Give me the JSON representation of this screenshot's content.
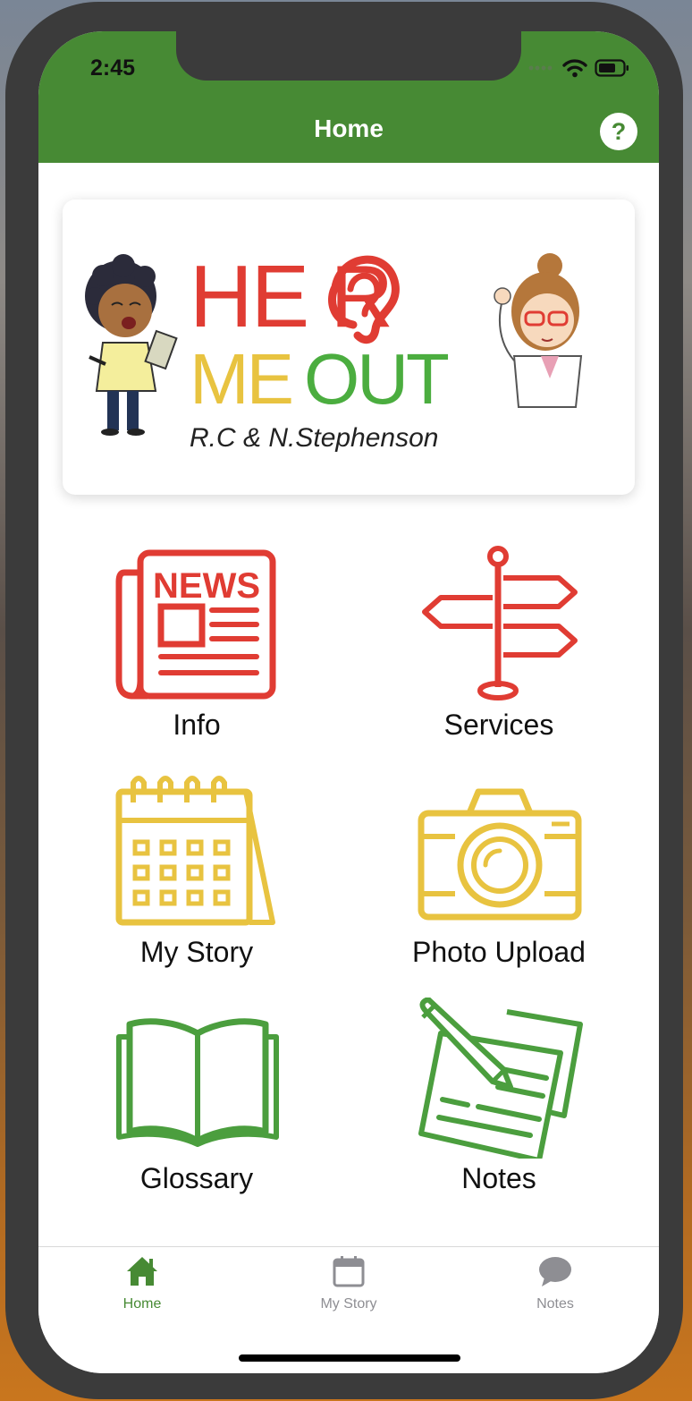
{
  "status_bar": {
    "time": "2:45"
  },
  "header": {
    "title": "Home",
    "help_label": "?"
  },
  "banner": {
    "line1": "HE R",
    "line2_left": "ME",
    "line2_right": "OUT",
    "authors": "R.C & N.Stephenson"
  },
  "tiles": [
    {
      "label": "Info",
      "icon": "newspaper-icon",
      "color": "#e03c33"
    },
    {
      "label": "Services",
      "icon": "signpost-icon",
      "color": "#e03c33"
    },
    {
      "label": "My Story",
      "icon": "calendar-icon",
      "color": "#e8c340"
    },
    {
      "label": "Photo Upload",
      "icon": "camera-icon",
      "color": "#e8c340"
    },
    {
      "label": "Glossary",
      "icon": "book-icon",
      "color": "#4b9e3e"
    },
    {
      "label": "Notes",
      "icon": "notes-icon",
      "color": "#4b9e3e"
    }
  ],
  "newspaper_text": "NEWS",
  "tabbar": [
    {
      "label": "Home",
      "icon": "home-icon",
      "active": true
    },
    {
      "label": "My Story",
      "icon": "calendar-icon",
      "active": false
    },
    {
      "label": "Notes",
      "icon": "chat-bubble-icon",
      "active": false
    }
  ],
  "colors": {
    "header_green": "#478a34",
    "active_tab": "#478a34",
    "inactive_tab": "#8e8e93",
    "red": "#e03c33",
    "yellow": "#e8c340",
    "green": "#4b9e3e"
  }
}
